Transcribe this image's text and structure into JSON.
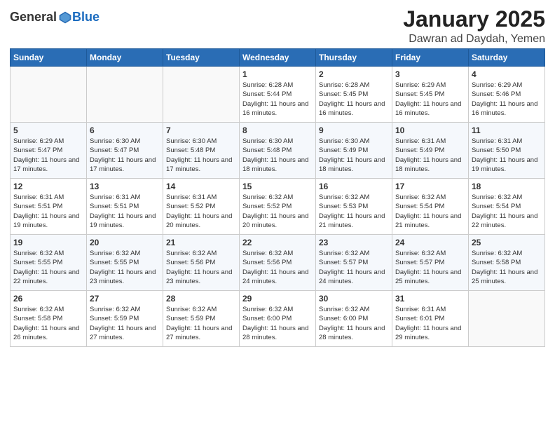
{
  "app": {
    "logo_general": "General",
    "logo_blue": "Blue"
  },
  "header": {
    "month_title": "January 2025",
    "location": "Dawran ad Daydah, Yemen"
  },
  "weekdays": [
    "Sunday",
    "Monday",
    "Tuesday",
    "Wednesday",
    "Thursday",
    "Friday",
    "Saturday"
  ],
  "weeks": [
    [
      {
        "day": "",
        "sunrise": "",
        "sunset": "",
        "daylight": ""
      },
      {
        "day": "",
        "sunrise": "",
        "sunset": "",
        "daylight": ""
      },
      {
        "day": "",
        "sunrise": "",
        "sunset": "",
        "daylight": ""
      },
      {
        "day": "1",
        "sunrise": "Sunrise: 6:28 AM",
        "sunset": "Sunset: 5:44 PM",
        "daylight": "Daylight: 11 hours and 16 minutes."
      },
      {
        "day": "2",
        "sunrise": "Sunrise: 6:28 AM",
        "sunset": "Sunset: 5:45 PM",
        "daylight": "Daylight: 11 hours and 16 minutes."
      },
      {
        "day": "3",
        "sunrise": "Sunrise: 6:29 AM",
        "sunset": "Sunset: 5:45 PM",
        "daylight": "Daylight: 11 hours and 16 minutes."
      },
      {
        "day": "4",
        "sunrise": "Sunrise: 6:29 AM",
        "sunset": "Sunset: 5:46 PM",
        "daylight": "Daylight: 11 hours and 16 minutes."
      }
    ],
    [
      {
        "day": "5",
        "sunrise": "Sunrise: 6:29 AM",
        "sunset": "Sunset: 5:47 PM",
        "daylight": "Daylight: 11 hours and 17 minutes."
      },
      {
        "day": "6",
        "sunrise": "Sunrise: 6:30 AM",
        "sunset": "Sunset: 5:47 PM",
        "daylight": "Daylight: 11 hours and 17 minutes."
      },
      {
        "day": "7",
        "sunrise": "Sunrise: 6:30 AM",
        "sunset": "Sunset: 5:48 PM",
        "daylight": "Daylight: 11 hours and 17 minutes."
      },
      {
        "day": "8",
        "sunrise": "Sunrise: 6:30 AM",
        "sunset": "Sunset: 5:48 PM",
        "daylight": "Daylight: 11 hours and 18 minutes."
      },
      {
        "day": "9",
        "sunrise": "Sunrise: 6:30 AM",
        "sunset": "Sunset: 5:49 PM",
        "daylight": "Daylight: 11 hours and 18 minutes."
      },
      {
        "day": "10",
        "sunrise": "Sunrise: 6:31 AM",
        "sunset": "Sunset: 5:49 PM",
        "daylight": "Daylight: 11 hours and 18 minutes."
      },
      {
        "day": "11",
        "sunrise": "Sunrise: 6:31 AM",
        "sunset": "Sunset: 5:50 PM",
        "daylight": "Daylight: 11 hours and 19 minutes."
      }
    ],
    [
      {
        "day": "12",
        "sunrise": "Sunrise: 6:31 AM",
        "sunset": "Sunset: 5:51 PM",
        "daylight": "Daylight: 11 hours and 19 minutes."
      },
      {
        "day": "13",
        "sunrise": "Sunrise: 6:31 AM",
        "sunset": "Sunset: 5:51 PM",
        "daylight": "Daylight: 11 hours and 19 minutes."
      },
      {
        "day": "14",
        "sunrise": "Sunrise: 6:31 AM",
        "sunset": "Sunset: 5:52 PM",
        "daylight": "Daylight: 11 hours and 20 minutes."
      },
      {
        "day": "15",
        "sunrise": "Sunrise: 6:32 AM",
        "sunset": "Sunset: 5:52 PM",
        "daylight": "Daylight: 11 hours and 20 minutes."
      },
      {
        "day": "16",
        "sunrise": "Sunrise: 6:32 AM",
        "sunset": "Sunset: 5:53 PM",
        "daylight": "Daylight: 11 hours and 21 minutes."
      },
      {
        "day": "17",
        "sunrise": "Sunrise: 6:32 AM",
        "sunset": "Sunset: 5:54 PM",
        "daylight": "Daylight: 11 hours and 21 minutes."
      },
      {
        "day": "18",
        "sunrise": "Sunrise: 6:32 AM",
        "sunset": "Sunset: 5:54 PM",
        "daylight": "Daylight: 11 hours and 22 minutes."
      }
    ],
    [
      {
        "day": "19",
        "sunrise": "Sunrise: 6:32 AM",
        "sunset": "Sunset: 5:55 PM",
        "daylight": "Daylight: 11 hours and 22 minutes."
      },
      {
        "day": "20",
        "sunrise": "Sunrise: 6:32 AM",
        "sunset": "Sunset: 5:55 PM",
        "daylight": "Daylight: 11 hours and 23 minutes."
      },
      {
        "day": "21",
        "sunrise": "Sunrise: 6:32 AM",
        "sunset": "Sunset: 5:56 PM",
        "daylight": "Daylight: 11 hours and 23 minutes."
      },
      {
        "day": "22",
        "sunrise": "Sunrise: 6:32 AM",
        "sunset": "Sunset: 5:56 PM",
        "daylight": "Daylight: 11 hours and 24 minutes."
      },
      {
        "day": "23",
        "sunrise": "Sunrise: 6:32 AM",
        "sunset": "Sunset: 5:57 PM",
        "daylight": "Daylight: 11 hours and 24 minutes."
      },
      {
        "day": "24",
        "sunrise": "Sunrise: 6:32 AM",
        "sunset": "Sunset: 5:57 PM",
        "daylight": "Daylight: 11 hours and 25 minutes."
      },
      {
        "day": "25",
        "sunrise": "Sunrise: 6:32 AM",
        "sunset": "Sunset: 5:58 PM",
        "daylight": "Daylight: 11 hours and 25 minutes."
      }
    ],
    [
      {
        "day": "26",
        "sunrise": "Sunrise: 6:32 AM",
        "sunset": "Sunset: 5:58 PM",
        "daylight": "Daylight: 11 hours and 26 minutes."
      },
      {
        "day": "27",
        "sunrise": "Sunrise: 6:32 AM",
        "sunset": "Sunset: 5:59 PM",
        "daylight": "Daylight: 11 hours and 27 minutes."
      },
      {
        "day": "28",
        "sunrise": "Sunrise: 6:32 AM",
        "sunset": "Sunset: 5:59 PM",
        "daylight": "Daylight: 11 hours and 27 minutes."
      },
      {
        "day": "29",
        "sunrise": "Sunrise: 6:32 AM",
        "sunset": "Sunset: 6:00 PM",
        "daylight": "Daylight: 11 hours and 28 minutes."
      },
      {
        "day": "30",
        "sunrise": "Sunrise: 6:32 AM",
        "sunset": "Sunset: 6:00 PM",
        "daylight": "Daylight: 11 hours and 28 minutes."
      },
      {
        "day": "31",
        "sunrise": "Sunrise: 6:31 AM",
        "sunset": "Sunset: 6:01 PM",
        "daylight": "Daylight: 11 hours and 29 minutes."
      },
      {
        "day": "",
        "sunrise": "",
        "sunset": "",
        "daylight": ""
      }
    ]
  ]
}
